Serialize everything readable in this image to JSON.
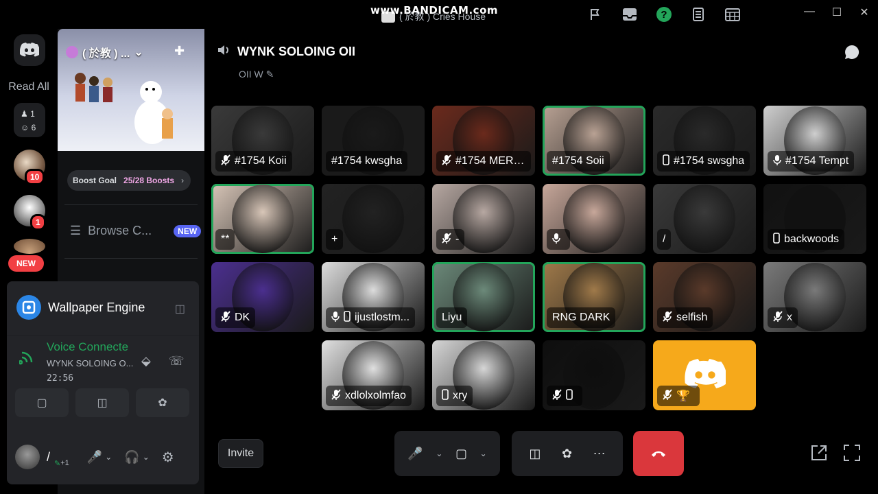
{
  "watermark": "www.BANDICAM.com",
  "window": {
    "title": "( 於教 ) Cries House",
    "icons": [
      "flag-icon",
      "inbox-icon",
      "help-icon",
      "notes-icon",
      "calendar-icon"
    ],
    "controls": [
      "minimize",
      "maximize",
      "close"
    ]
  },
  "rail": {
    "read_all": "Read All",
    "friends_count": "1",
    "discord_count": "6",
    "badge_1": "10",
    "badge_2": "1",
    "new_label": "NEW"
  },
  "server": {
    "name": "( 於教 ) ...",
    "boost_goal": "Boost Goal",
    "boost_count": "25/28 Boosts",
    "browse": "Browse C...",
    "browse_tag": "NEW"
  },
  "activity": {
    "app_name": "Wallpaper Engine"
  },
  "voice": {
    "status": "Voice Connecte",
    "channel": "WYNK SOLOING O...",
    "time": "22:56"
  },
  "user": {
    "name": "/",
    "extra": "+1"
  },
  "channel": {
    "title": "WYNK SOLOING OII",
    "subtitle": "OII W"
  },
  "participants": [
    {
      "name": "#1754 Koii",
      "muted": true,
      "device": "",
      "speaking": false,
      "color": "#3a3a3a"
    },
    {
      "name": "#1754 kwsgha",
      "muted": false,
      "device": "",
      "speaking": false,
      "color": "#1a1a1a"
    },
    {
      "name": "#1754 MERR...",
      "muted": true,
      "device": "",
      "speaking": false,
      "color": "#6b2a1c"
    },
    {
      "name": "#1754 Soii",
      "muted": false,
      "device": "",
      "speaking": true,
      "color": "#b9a294"
    },
    {
      "name": "#1754 swsgha",
      "muted": false,
      "device": "phone",
      "speaking": false,
      "color": "#2a2a2a"
    },
    {
      "name": "#1754 Tempt",
      "muted": false,
      "device": "mic",
      "speaking": false,
      "color": "#cfcfcf"
    },
    {
      "name": "**",
      "muted": false,
      "device": "",
      "speaking": true,
      "color": "#d8c6b8"
    },
    {
      "name": "+",
      "muted": false,
      "device": "",
      "speaking": false,
      "color": "#222"
    },
    {
      "name": "-",
      "muted": true,
      "device": "",
      "speaking": false,
      "color": "#b7a8a2"
    },
    {
      "name": "",
      "muted": false,
      "device": "mic",
      "speaking": false,
      "color": "#c7a79a"
    },
    {
      "name": "/",
      "muted": false,
      "device": "",
      "speaking": false,
      "color": "#3a3a3a"
    },
    {
      "name": "backwoods",
      "muted": false,
      "device": "phone",
      "speaking": false,
      "color": "#111"
    },
    {
      "name": "DK",
      "muted": true,
      "device": "",
      "speaking": false,
      "color": "#4b2f8f"
    },
    {
      "name": "ijustlostm...",
      "muted": false,
      "device": "mic-phone",
      "speaking": false,
      "color": "#dcdcdc"
    },
    {
      "name": "Liyu",
      "muted": false,
      "device": "",
      "speaking": true,
      "color": "#6c8a7a"
    },
    {
      "name": "RNG DARK",
      "muted": false,
      "device": "",
      "speaking": true,
      "color": "#a07a4a"
    },
    {
      "name": "selfish",
      "muted": true,
      "device": "",
      "speaking": false,
      "color": "#5a3a2a"
    },
    {
      "name": "x",
      "muted": true,
      "device": "",
      "speaking": false,
      "color": "#7a7a7a"
    },
    {
      "name": "xdlolxolmfao",
      "muted": true,
      "device": "",
      "speaking": false,
      "color": "#e0e0e0"
    },
    {
      "name": "xry",
      "muted": false,
      "device": "phone",
      "speaking": false,
      "color": "#d6d6d6"
    },
    {
      "name": "",
      "muted": true,
      "device": "phone",
      "speaking": false,
      "color": "#0e0e0e"
    },
    {
      "name": "",
      "muted": true,
      "device": "trophy",
      "speaking": false,
      "color": "#f6a91b"
    }
  ],
  "controls": {
    "invite": "Invite"
  },
  "colors": {
    "speaking": "#23a55a",
    "end_call": "#da373c",
    "blurple": "#5865f2"
  }
}
